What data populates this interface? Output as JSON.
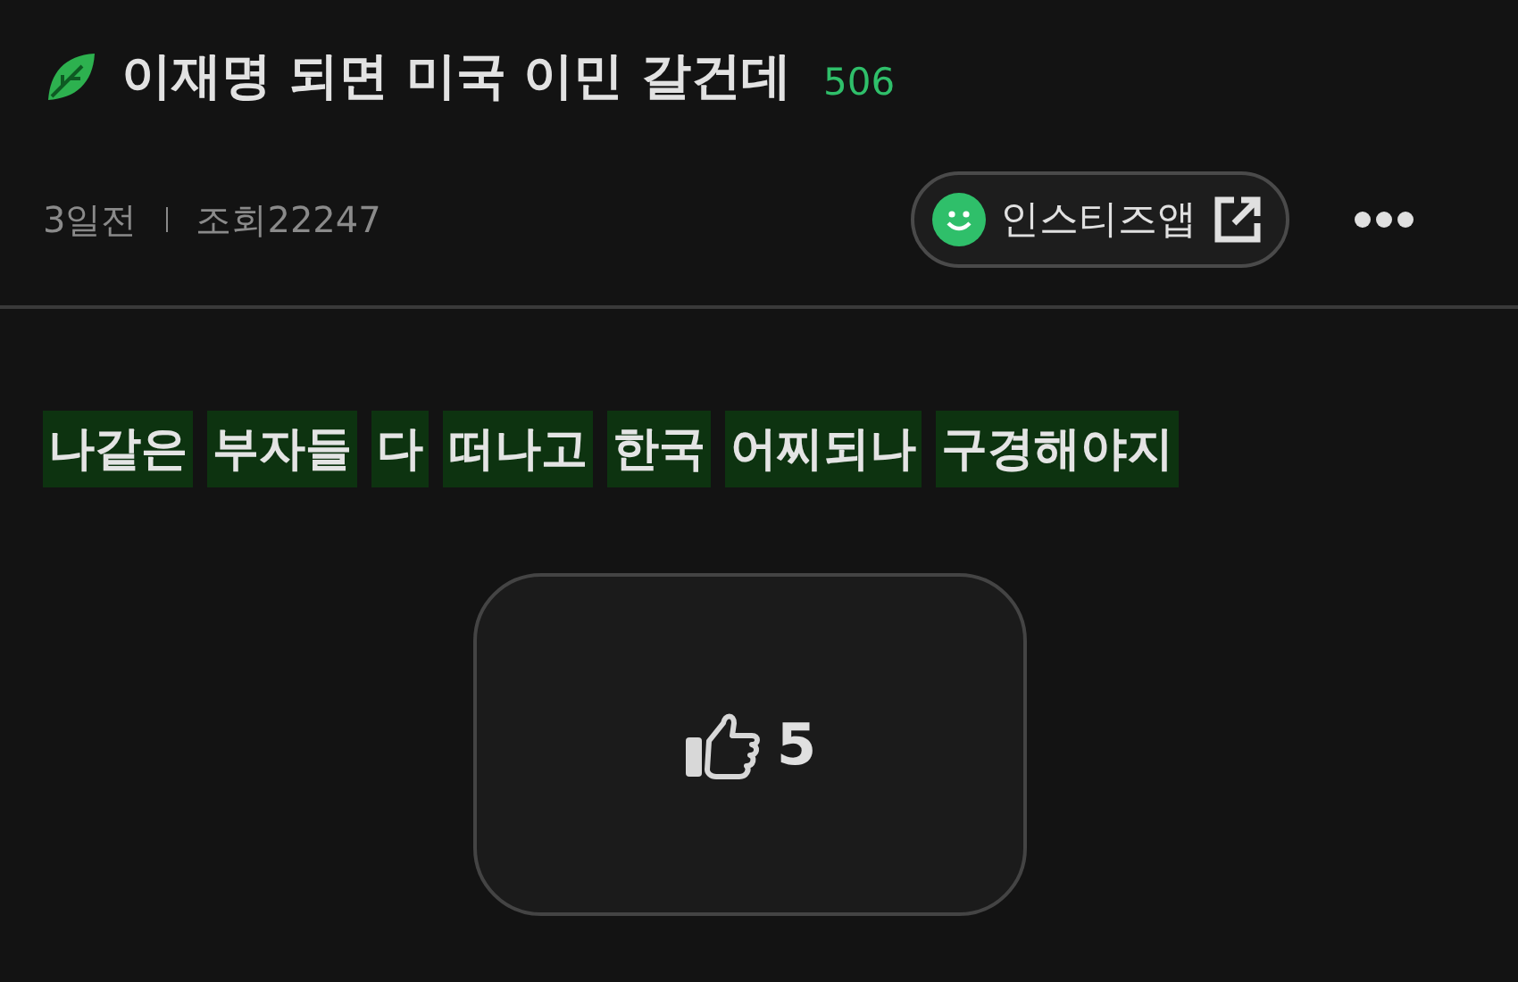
{
  "post": {
    "title": "이재명 되면 미국 이민 갈건데",
    "comment_count": "506",
    "time": "3일전",
    "views": "조회22247",
    "app_button": "인스티즈앱"
  },
  "body": {
    "words": [
      "나같은",
      "부자들",
      "다",
      "떠나고",
      "한국",
      "어찌되나",
      "구경해야지"
    ]
  },
  "like": {
    "count": "5"
  }
}
